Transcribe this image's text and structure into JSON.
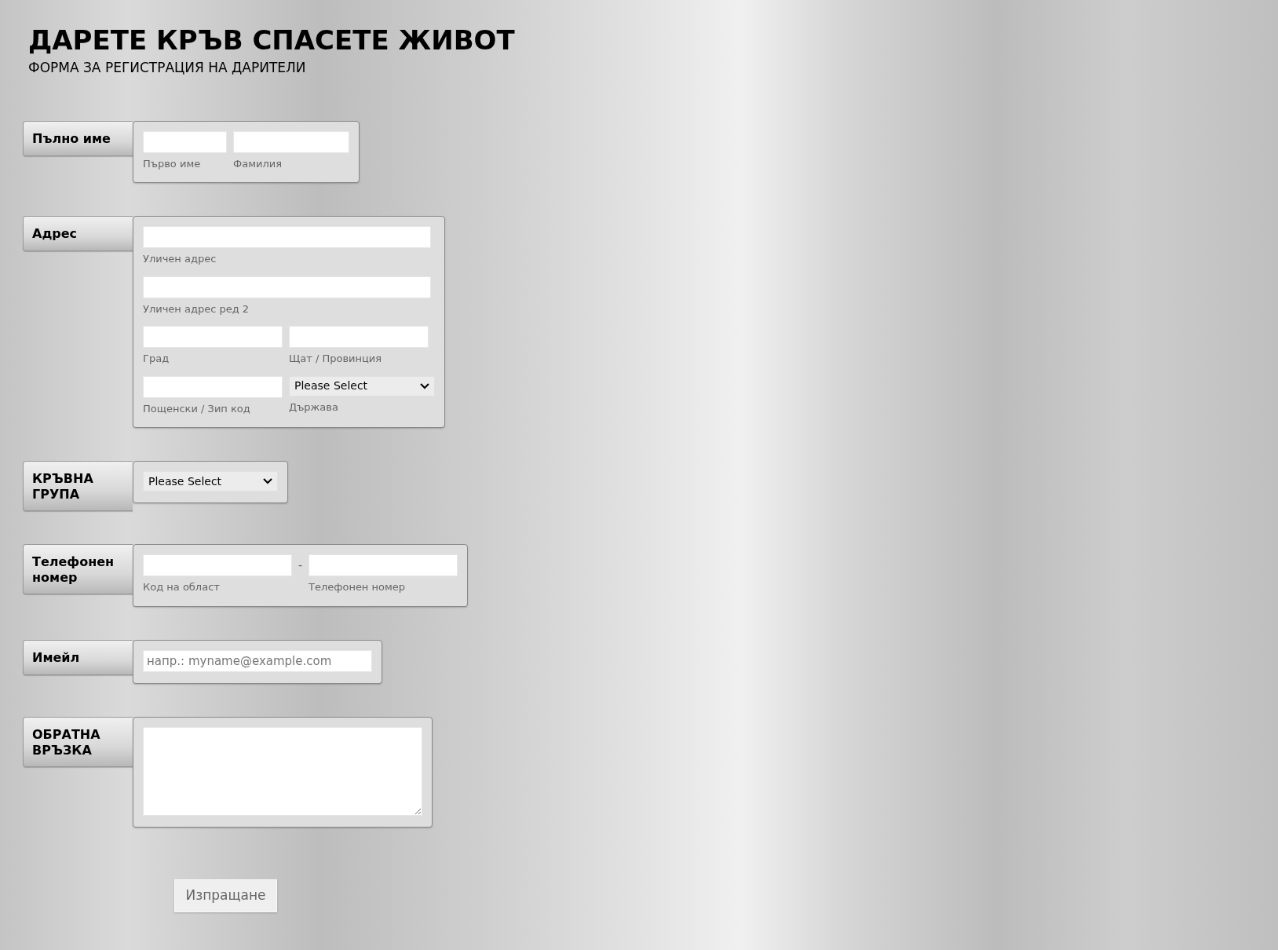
{
  "header": {
    "title": "ДАРЕТЕ КРЪВ СПАСЕТЕ ЖИВОТ",
    "subtitle": "ФОРМА ЗА РЕГИСТРАЦИЯ НА ДАРИТЕЛИ"
  },
  "sections": [
    {
      "kind": "name",
      "label": "Пълно име",
      "rows": [
        [
          {
            "kind": "input",
            "sublabel": "Първо име"
          },
          {
            "kind": "input",
            "sublabel": "Фамилия"
          }
        ]
      ]
    },
    {
      "kind": "address",
      "label": "Адрес",
      "rows": [
        [
          {
            "kind": "input",
            "sublabel": "Уличен адрес"
          }
        ],
        [
          {
            "kind": "input",
            "sublabel": "Уличен адрес ред 2"
          }
        ],
        [
          {
            "kind": "input",
            "sublabel": "Град"
          },
          {
            "kind": "input",
            "sublabel": "Щат / Провинция"
          }
        ],
        [
          {
            "kind": "input",
            "sublabel": "Пощенски / Зип код"
          },
          {
            "kind": "select",
            "value": "Please Select",
            "sublabel": "Държава"
          }
        ]
      ]
    },
    {
      "kind": "blood",
      "label": "КРЪВНА ГРУПА",
      "rows": [
        [
          {
            "kind": "select",
            "value": "Please Select"
          }
        ]
      ]
    },
    {
      "kind": "phone",
      "label": "Телефонен номер",
      "separator": "-",
      "rows": [
        [
          {
            "kind": "input",
            "sublabel": "Код на област"
          },
          {
            "kind": "input",
            "sublabel": "Телефонен номер"
          }
        ]
      ]
    },
    {
      "kind": "email",
      "label": "Имейл",
      "rows": [
        [
          {
            "kind": "input",
            "placeholder": "напр.: myname@example.com"
          }
        ]
      ]
    },
    {
      "kind": "feedback",
      "label": "ОБРАТНА ВРЪЗКА",
      "rows": [
        [
          {
            "kind": "textarea"
          }
        ]
      ]
    }
  ],
  "submit": "Изпращане"
}
